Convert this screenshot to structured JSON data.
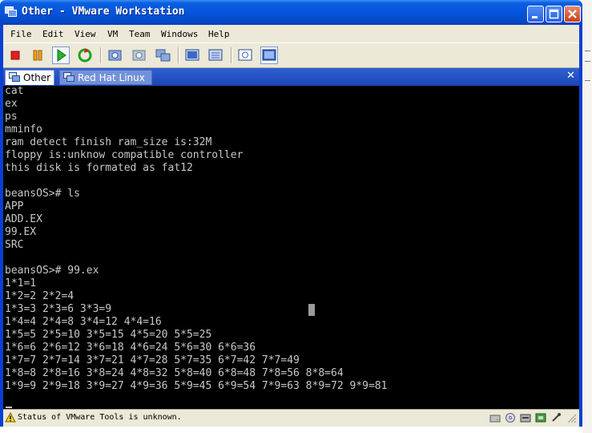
{
  "window": {
    "title": "Other - VMware Workstation"
  },
  "menu": {
    "items": [
      "File",
      "Edit",
      "View",
      "VM",
      "Team",
      "Windows",
      "Help"
    ]
  },
  "toolbar": {
    "icons": [
      "stop-icon",
      "pause-icon",
      "play-icon",
      "reset-icon",
      "snapshot-icon",
      "revert-snapshot-icon",
      "snapshot-manager-icon",
      "full-screen-icon",
      "quick-switch-icon",
      "summary-view-icon",
      "console-view-icon"
    ]
  },
  "tabs": [
    {
      "label": "Other",
      "active": true
    },
    {
      "label": "Red Hat Linux",
      "active": false
    }
  ],
  "console": {
    "lines": [
      "cat",
      "ex",
      "ps",
      "mminfo",
      "ram detect finish ram_size is:32M",
      "floppy is:unknow compatible controller",
      "this disk is formated as fat12",
      "",
      "beansOS># ls",
      "APP",
      "ADD.EX",
      "99.EX",
      "SRC",
      "",
      "beansOS># 99.ex",
      "1*1=1",
      "1*2=2 2*2=4",
      "1*3=3 2*3=6 3*3=9",
      "1*4=4 2*4=8 3*4=12 4*4=16",
      "1*5=5 2*5=10 3*5=15 4*5=20 5*5=25",
      "1*6=6 2*6=12 3*6=18 4*6=24 5*6=30 6*6=36",
      "1*7=7 2*7=14 3*7=21 4*7=28 5*7=35 6*7=42 7*7=49",
      "1*8=8 2*8=16 3*8=24 4*8=32 5*8=40 6*8=48 7*8=56 8*8=64",
      "1*9=9 2*9=18 3*9=27 4*9=36 5*9=45 6*9=54 7*9=63 8*9=72 9*9=81"
    ]
  },
  "status": {
    "text": "Status of VMware Tools is unknown."
  },
  "colors": {
    "title_bar": "#0654dc",
    "console_bg": "#000000",
    "console_fg": "#c8c8c8",
    "chrome": "#ece9d8"
  }
}
